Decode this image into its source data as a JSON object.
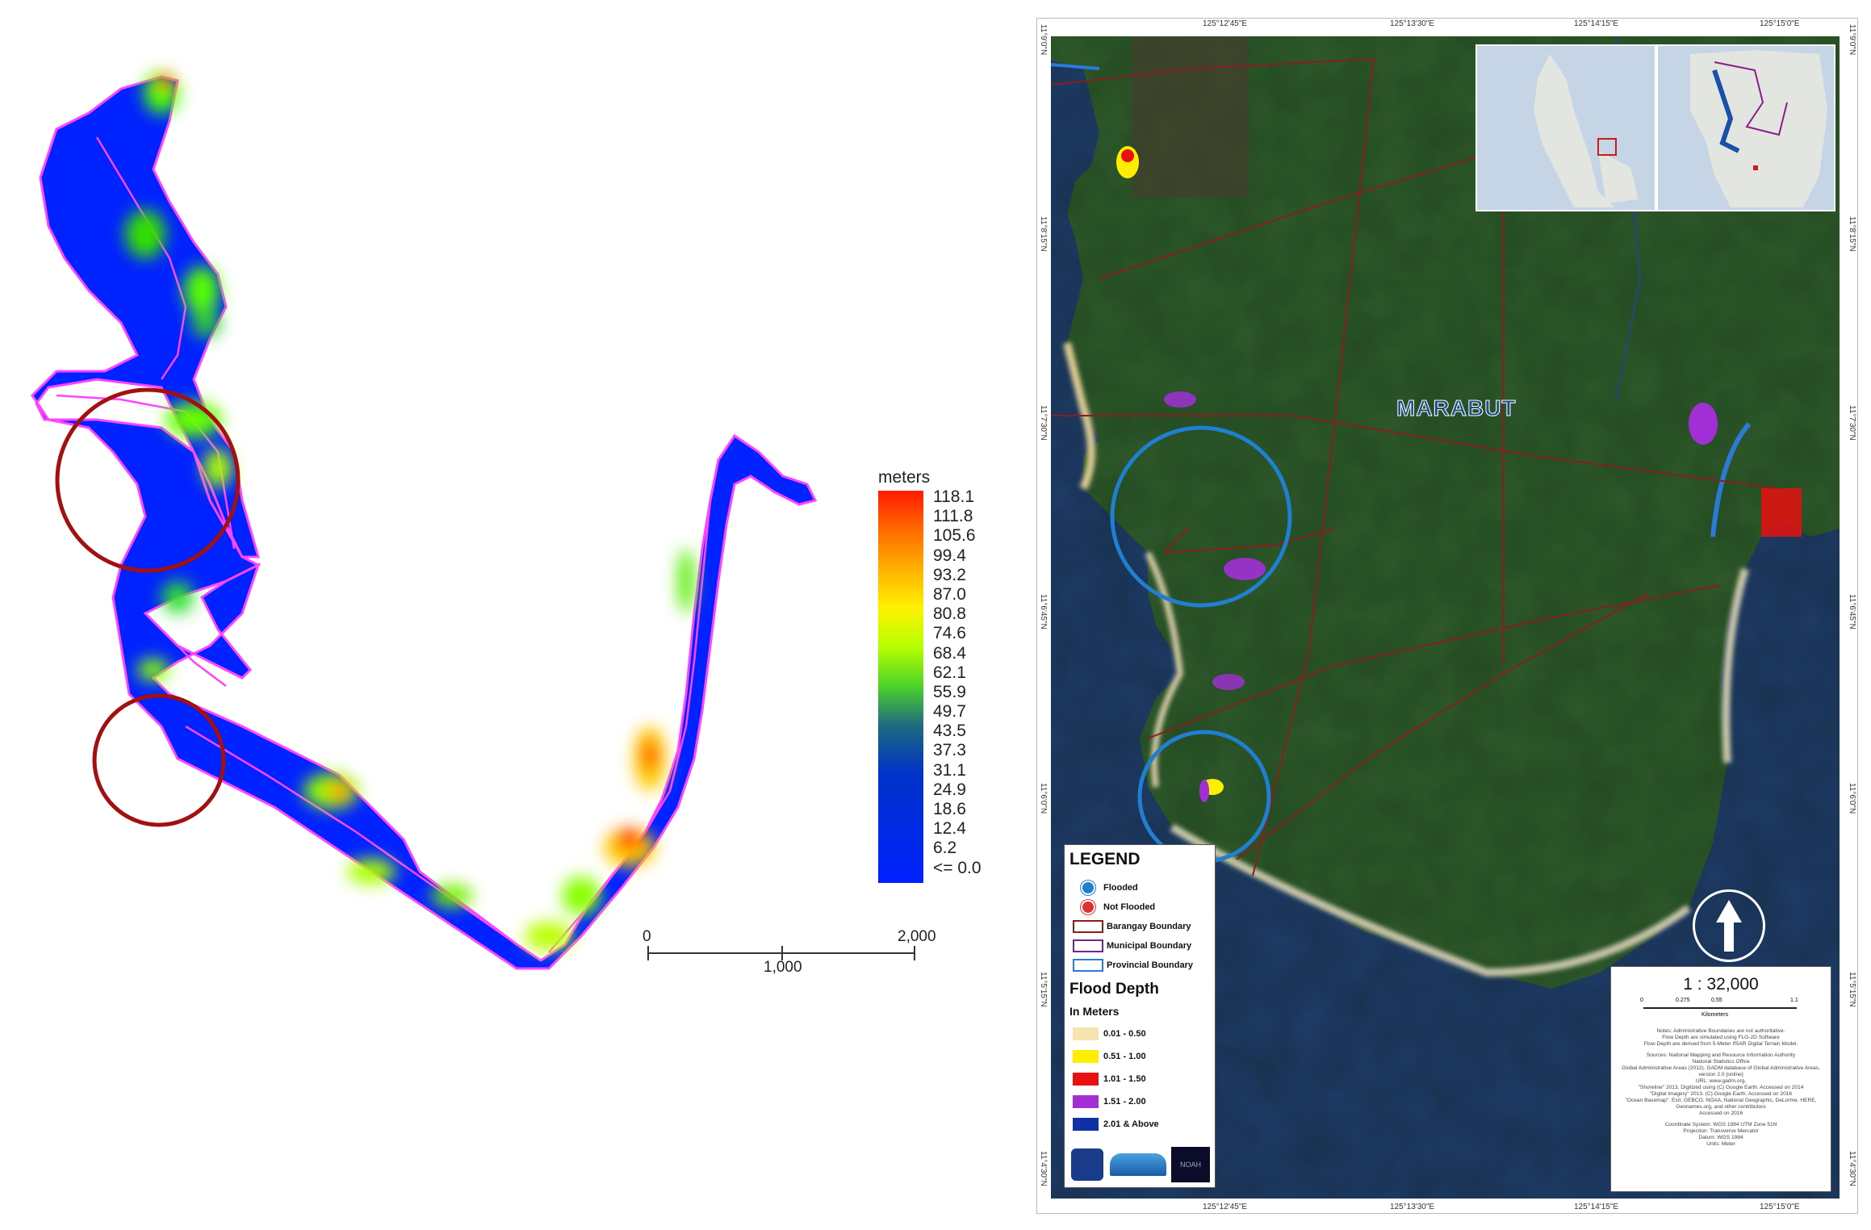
{
  "left_panel": {
    "legend_title": "meters",
    "ramp_labels": [
      "118.1",
      "111.8",
      "105.6",
      "99.4",
      "93.2",
      "87.0",
      "80.8",
      "74.6",
      "68.4",
      "62.1",
      "55.9",
      "49.7",
      "43.5",
      "37.3",
      "31.1",
      "24.9",
      "18.6",
      "12.4",
      "6.2",
      "<= 0.0"
    ],
    "scale": {
      "zero": "0",
      "mid": "1,000",
      "end": "2,000"
    },
    "colors": {
      "flood_fill": "#0022ff",
      "boundary": "#ff44ff",
      "highlight_circle": "#a31010"
    }
  },
  "right_panel": {
    "municipality_label": "MARABUT",
    "top_coords": [
      "125°12'45\"E",
      "125°13'30\"E",
      "125°14'15\"E",
      "125°15'0\"E"
    ],
    "bottom_coords": [
      "125°12'45\"E",
      "125°13'30\"E",
      "125°14'15\"E",
      "125°15'0\"E"
    ],
    "side_coords": [
      "11°9'0\"N",
      "11°8'15\"N",
      "11°7'30\"N",
      "11°6'45\"N",
      "11°6'0\"N",
      "11°5'15\"N",
      "11°4'30\"N"
    ],
    "legend": {
      "title": "LEGEND",
      "flooded": "Flooded",
      "not_flooded": "Not Flooded",
      "barangay": "Barangay Boundary",
      "municipal": "Municipal Boundary",
      "provincial": "Provincial Boundary",
      "flood_depth_title": "Flood Depth",
      "in_meters": "In Meters",
      "classes": [
        {
          "label": "0.01 - 0.50",
          "color": "#f3e4b0"
        },
        {
          "label": "0.51 - 1.00",
          "color": "#ffee00"
        },
        {
          "label": "1.01 - 1.50",
          "color": "#e81010"
        },
        {
          "label": "1.51 - 2.00",
          "color": "#a22fd6"
        },
        {
          "label": "2.01 & Above",
          "color": "#1030a8"
        }
      ],
      "logo_text": "NOAH"
    },
    "scale_box": {
      "ratio": "1 : 32,000",
      "ticks": [
        "0",
        "0.275",
        "0.55",
        "",
        "1.1"
      ],
      "unit": "Kilometers",
      "notes": [
        "Notes: Administrative Boundaries are not authoritative.",
        "Flow Depth are simulated using FLO-2D Software",
        "Flow Depth are derived from 5-Meter IfSAR Digital Terrain Model.",
        "Sources: National Mapping and Resource Information Authority",
        "National Statistics Office",
        "Global Administrative Areas (2012). GADM database of Global Administrative Areas, version 2.0 [online]",
        "URL: www.gadm.org.",
        "\"Shoreline\" 2013. Digitized using (C) Google Earth. Accessed on 2014",
        "\"Digital Imagery\" 2013. (C) Google Earth. Accessed on 2016",
        "\"Ocean Basemap\". Esri, GEBCO, NOAA, National Geographic, DeLorme, HERE, Geonames.org, and other contributors",
        "Accessed on 2016",
        "Coordinate System: WGS 1984 UTM Zone 51N",
        "Projection: Transverse Mercator",
        "Datum: WGS 1984",
        "Units: Meter"
      ]
    },
    "colors": {
      "vegetation": "#2f5a2c",
      "sea": "#1f3c6a",
      "circle": "#1f7fd0",
      "barangay_line": "#8a1d1d",
      "municipal_line": "#6a2a8a",
      "provincial_line": "#2b7ad8"
    }
  }
}
